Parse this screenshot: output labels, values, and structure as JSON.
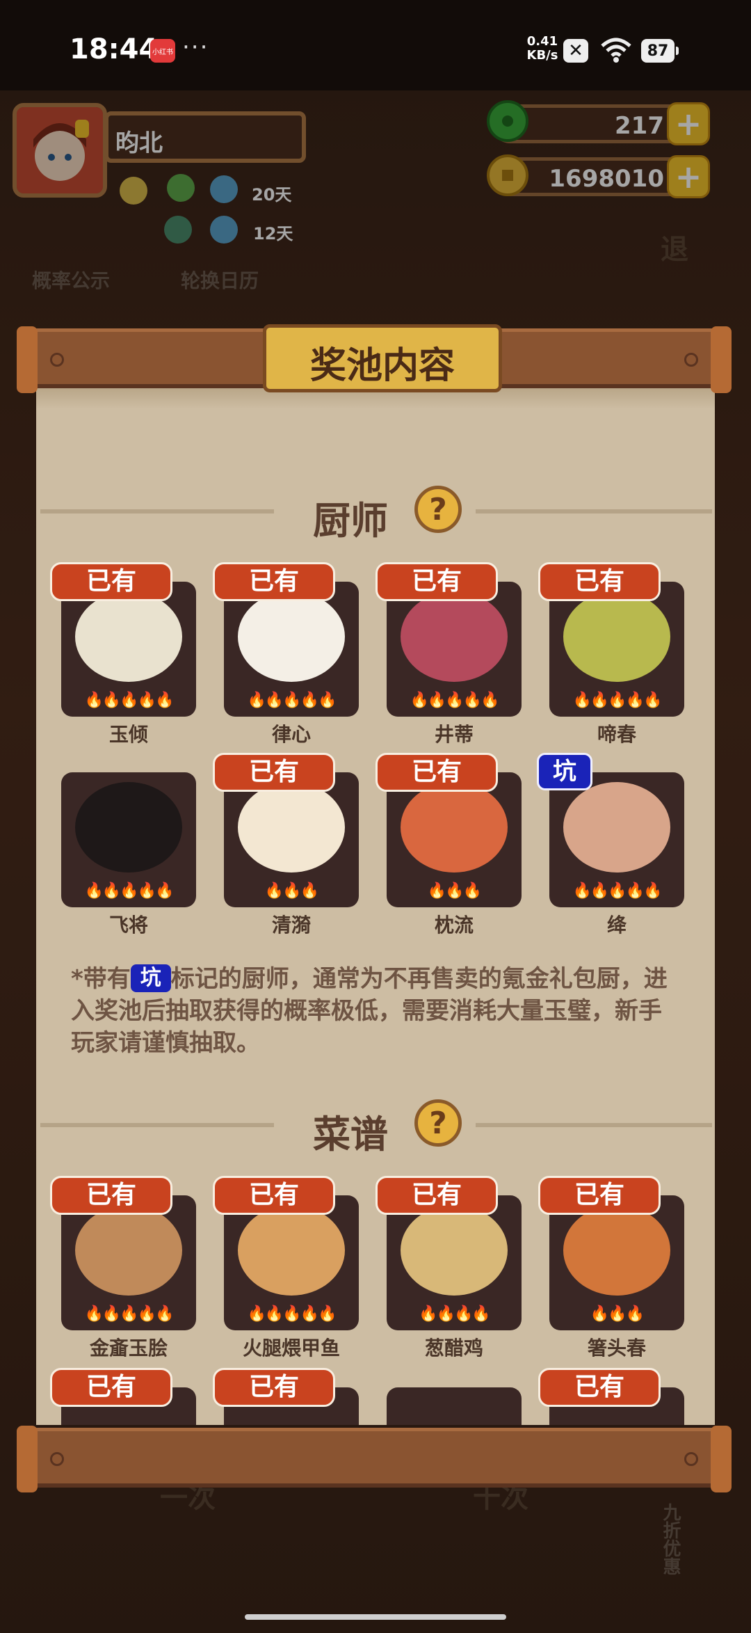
{
  "status_bar": {
    "time": "18:44",
    "app_badge": "小红书",
    "more": "···",
    "net_speed_value": "0.41",
    "net_speed_unit": "KB/s",
    "battery": "87"
  },
  "player": {
    "name": "昀北",
    "badge_days_1": "20天",
    "badge_days_2": "12天"
  },
  "currency": {
    "jade": "217",
    "coins": "1698010"
  },
  "background": {
    "probability_label": "概率公示",
    "calendar_label": "轮换日历",
    "exit_label": "退",
    "single_draw": "一次",
    "ten_draw": "十次",
    "discount": "九折优惠"
  },
  "panel": {
    "title": "奖池内容",
    "chef_section": "厨师",
    "recipe_section": "菜谱",
    "owned_label": "已有",
    "pit_label": "坑",
    "note_prefix": "*带有",
    "note_suffix": "标记的厨师，通常为不再售卖的氪金礼包厨，进入奖池后抽取获得的概率极低，需要消耗大量玉璧，新手玩家请谨慎抽取。"
  },
  "chefs": [
    {
      "name": "玉倾",
      "owned": true,
      "stars": 5,
      "color": "#e9e2cf"
    },
    {
      "name": "律心",
      "owned": true,
      "stars": 5,
      "color": "#f4efe6"
    },
    {
      "name": "井蒂",
      "owned": true,
      "stars": 5,
      "color": "#b44a5c"
    },
    {
      "name": "啼春",
      "owned": true,
      "stars": 5,
      "color": "#b8b94e"
    },
    {
      "name": "飞将",
      "owned": false,
      "stars": 5,
      "color": "#1e1818"
    },
    {
      "name": "清漪",
      "owned": true,
      "stars": 3,
      "color": "#f3e7d2"
    },
    {
      "name": "枕流",
      "owned": true,
      "stars": 3,
      "color": "#d9673f"
    },
    {
      "name": "绛",
      "owned": false,
      "pit": true,
      "stars": 5,
      "color": "#d8a58a"
    }
  ],
  "recipes": [
    {
      "name": "金齑玉脍",
      "owned": true,
      "stars": 5,
      "color": "#c08a5a"
    },
    {
      "name": "火腿煨甲鱼",
      "owned": true,
      "stars": 5,
      "color": "#d9a060"
    },
    {
      "name": "葱醋鸡",
      "owned": true,
      "stars": 4,
      "color": "#d8b878"
    },
    {
      "name": "箸头春",
      "owned": true,
      "stars": 3,
      "color": "#d2763a"
    }
  ],
  "recipes_row2_owned": [
    true,
    true,
    false,
    true
  ]
}
